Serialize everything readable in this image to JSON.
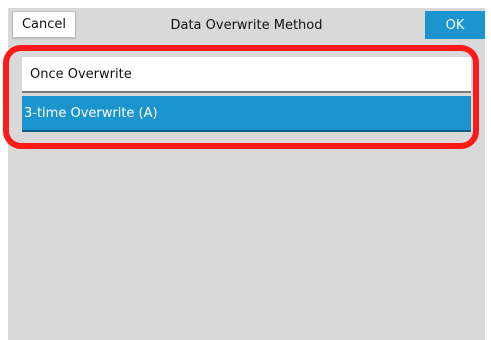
{
  "topbar": {
    "cancel_label": "Cancel",
    "title": "Data Overwrite Method",
    "ok_label": "OK"
  },
  "options": [
    {
      "label": "Once Overwrite",
      "selected": false
    },
    {
      "label": "3-time Overwrite (A)",
      "selected": true
    }
  ],
  "colors": {
    "accent": "#1c95cf",
    "background": "#d9d9d9",
    "highlight": "#ff1a1a"
  }
}
